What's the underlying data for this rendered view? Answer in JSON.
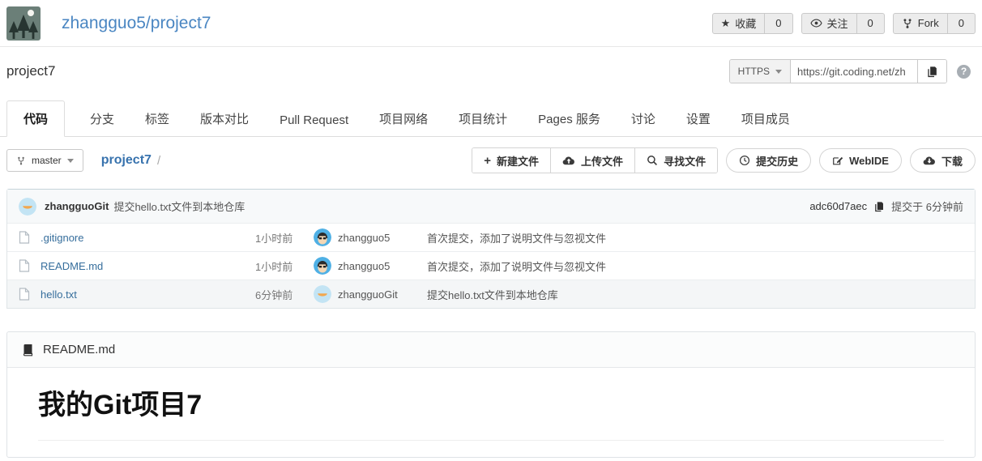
{
  "header": {
    "repo_title": "zhangguo5/project7",
    "actions": [
      {
        "name": "star",
        "label": "收藏",
        "count": "0"
      },
      {
        "name": "watch",
        "label": "关注",
        "count": "0"
      },
      {
        "name": "fork",
        "label": "Fork",
        "count": "0"
      }
    ]
  },
  "subheader": {
    "project_name": "project7",
    "protocol_label": "HTTPS",
    "clone_url": "https://git.coding.net/zh"
  },
  "tabs": [
    "代码",
    "分支",
    "标签",
    "版本对比",
    "Pull Request",
    "项目网络",
    "项目统计",
    "Pages 服务",
    "讨论",
    "设置",
    "项目成员"
  ],
  "toolbar": {
    "branch": "master",
    "path_root": "project7",
    "path_separator": "/",
    "group_buttons": [
      "新建文件",
      "上传文件",
      "寻找文件"
    ],
    "pill_buttons": [
      "提交历史",
      "WebIDE",
      "下载"
    ]
  },
  "commit_bar": {
    "author": "zhangguoGit",
    "message": "提交hello.txt文件到本地仓库",
    "sha": "adc60d7aec",
    "time": "提交于 6分钟前"
  },
  "files": [
    {
      "name": ".gitignore",
      "time": "1小时前",
      "author": "zhangguo5",
      "message": "首次提交，添加了说明文件与忽视文件"
    },
    {
      "name": "README.md",
      "time": "1小时前",
      "author": "zhangguo5",
      "message": "首次提交，添加了说明文件与忽视文件"
    },
    {
      "name": "hello.txt",
      "time": "6分钟前",
      "author": "zhangguoGit",
      "message": "提交hello.txt文件到本地仓库"
    }
  ],
  "readme": {
    "filename": "README.md",
    "heading": "我的Git项目7"
  },
  "colors": {
    "title_link": "#4a86c2",
    "file_link": "#366e9c",
    "path_link": "#3873ae",
    "commit_bar_bg": "#f7f9fa",
    "panel_border": "#dfe4e7"
  }
}
